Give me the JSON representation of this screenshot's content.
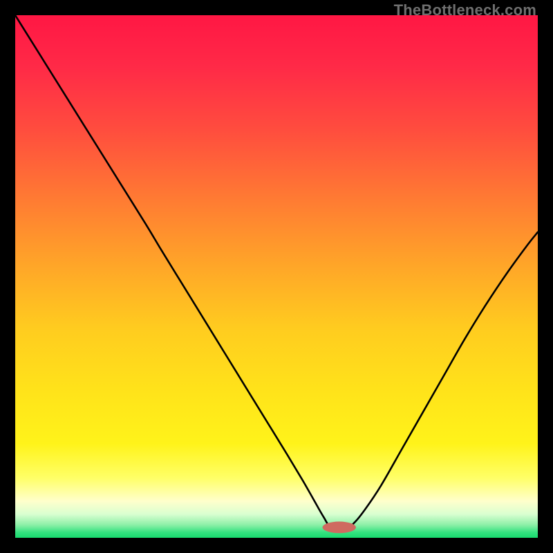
{
  "attribution": "TheBottleneck.com",
  "colors": {
    "frame": "#000000",
    "curve": "#000000",
    "marker": "#cf6a60",
    "gradient_stops": [
      {
        "offset": 0.0,
        "color": "#ff1744"
      },
      {
        "offset": 0.1,
        "color": "#ff2a47"
      },
      {
        "offset": 0.22,
        "color": "#ff4d3e"
      },
      {
        "offset": 0.35,
        "color": "#ff7a33"
      },
      {
        "offset": 0.48,
        "color": "#ffa628"
      },
      {
        "offset": 0.6,
        "color": "#ffcc1f"
      },
      {
        "offset": 0.72,
        "color": "#ffe31a"
      },
      {
        "offset": 0.82,
        "color": "#fff31a"
      },
      {
        "offset": 0.885,
        "color": "#ffff66"
      },
      {
        "offset": 0.93,
        "color": "#ffffcc"
      },
      {
        "offset": 0.955,
        "color": "#d9ffd0"
      },
      {
        "offset": 0.975,
        "color": "#8ef0a8"
      },
      {
        "offset": 0.99,
        "color": "#33e27f"
      },
      {
        "offset": 1.0,
        "color": "#18db6f"
      }
    ]
  },
  "chart_data": {
    "type": "line",
    "title": "",
    "xlabel": "",
    "ylabel": "",
    "xlim": [
      0,
      100
    ],
    "ylim": [
      0,
      100
    ],
    "x": [
      0,
      5,
      10,
      15,
      20,
      25,
      28,
      32,
      36,
      40,
      44,
      48,
      52,
      55,
      57,
      59,
      60.5,
      63.5,
      65,
      67,
      70,
      74,
      78,
      82,
      86,
      90,
      94,
      98,
      100
    ],
    "values": [
      100,
      92,
      84,
      76,
      68,
      60,
      55,
      48.5,
      42,
      35.5,
      29,
      22.5,
      16,
      11,
      7.5,
      4,
      2,
      2,
      3,
      5.5,
      10,
      17,
      24,
      31,
      38,
      44.5,
      50.5,
      56,
      58.5
    ],
    "marker": {
      "x": 62,
      "y": 2,
      "rx": 3.2,
      "ry": 1.1
    }
  }
}
